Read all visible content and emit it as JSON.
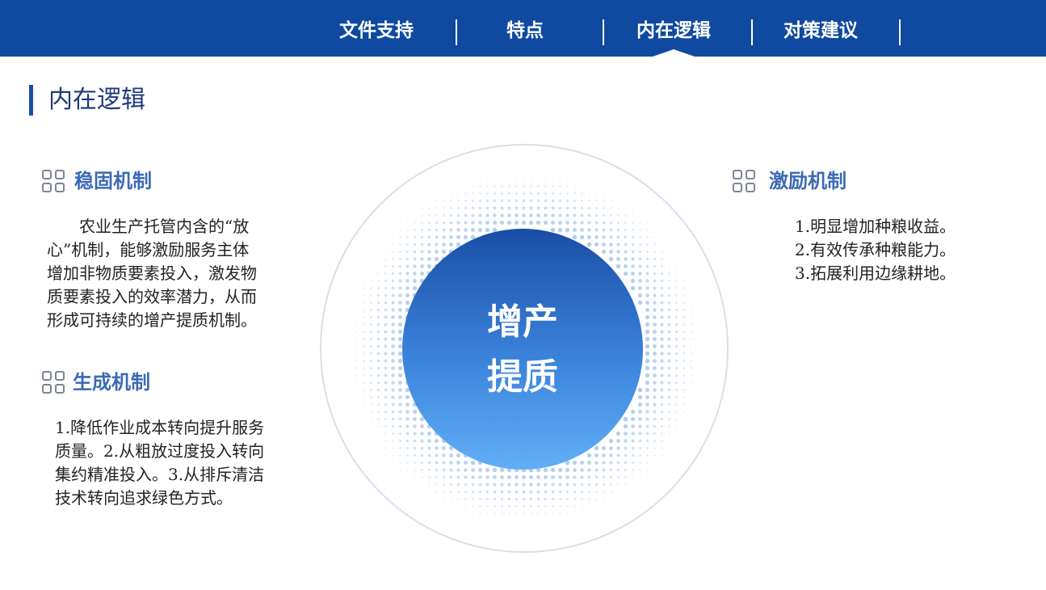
{
  "nav": {
    "items": [
      "文件支持",
      "特点",
      "内在逻辑",
      "对策建议"
    ],
    "active_index": 2
  },
  "section": {
    "title": "内在逻辑"
  },
  "blocks": {
    "stable": {
      "icon": "grid-icon",
      "title": "稳固机制",
      "lines": [
        "　　农业生产托管内含的“放",
        "心”机制，能够激励服务主体",
        "增加非物质要素投入，激发物",
        "质要素投入的效率潜力，从而",
        "形成可持续的增产提质机制。"
      ]
    },
    "generate": {
      "icon": "grid-icon",
      "title": "生成机制",
      "lines": [
        "1.降低作业成本转向提升服务",
        "质量。2.从粗放过度投入转向",
        "集约精准投入。3.从排斥清洁",
        "技术转向追求绿色方式。"
      ]
    },
    "incentive": {
      "icon": "grid-icon",
      "title": "激励机制",
      "lines": [
        " 1.明显增加种粮收益。",
        "2.有效传承种粮能力。",
        "3.拓展利用边缘耕地。"
      ]
    }
  },
  "center": {
    "line1": "增产",
    "line2": "提质"
  },
  "colors": {
    "nav_bg": "#0f4aa0",
    "accent": "#3b6ab5",
    "title": "#1f3a78"
  }
}
